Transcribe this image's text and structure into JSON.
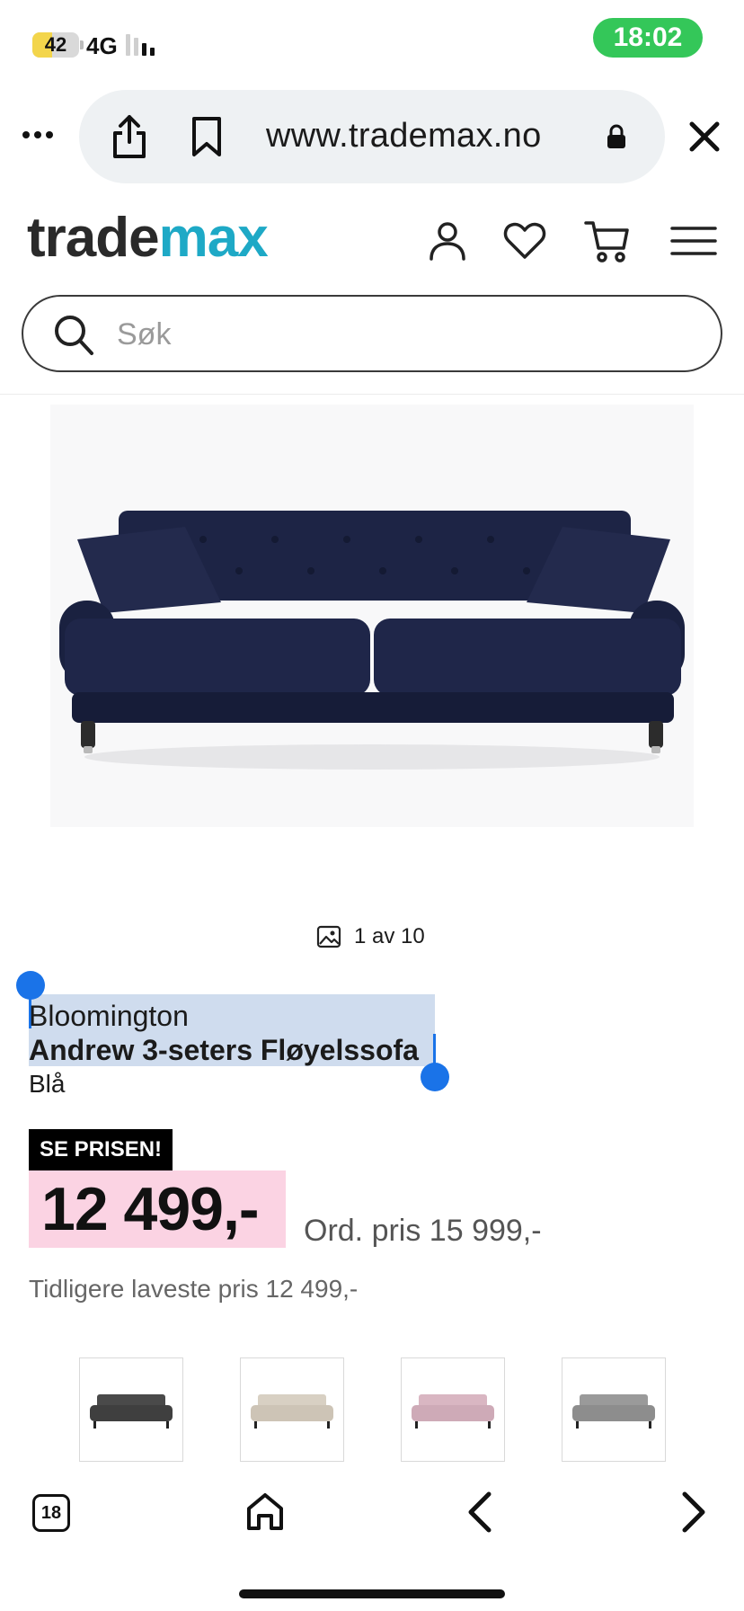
{
  "status_bar": {
    "battery_level": "42",
    "network": "4G",
    "time": "18:02"
  },
  "browser": {
    "url": "www.trademax.no",
    "icons": [
      "more-icon",
      "share-icon",
      "bookmark-icon",
      "lock-icon",
      "close-icon"
    ]
  },
  "header": {
    "logo_part1": "trade",
    "logo_part2": "max",
    "brand_color": "#1ea9c6",
    "icons": [
      "account-icon",
      "heart-icon",
      "cart-icon",
      "hamburger-menu-icon"
    ]
  },
  "search": {
    "placeholder": "Søk",
    "value": ""
  },
  "product": {
    "image_counter": "1 av 10",
    "brand": "Bloomington",
    "title": "Andrew 3-seters Fløyelssofa",
    "color": "Blå",
    "promo_label": "SE PRISEN!",
    "price": "12 499,-",
    "ordinary_price": "Ord. pris 15 999,-",
    "lowest_price": "Tidligere laveste pris 12 499,-",
    "color_variants": [
      {
        "name": "dark-grey",
        "color": "#4a4a4a"
      },
      {
        "name": "beige",
        "color": "#d8d0c3"
      },
      {
        "name": "pink",
        "color": "#d9b6c2"
      },
      {
        "name": "grey",
        "color": "#9a9a9a"
      }
    ],
    "sofa_color": "#1c2340"
  },
  "toolbar": {
    "tab_count": "18",
    "icons": [
      "tabs-icon",
      "home-icon",
      "back-arrow-icon",
      "forward-arrow-icon"
    ]
  },
  "selection_color": "#1a73e8",
  "accent_pink": "#fbd3e3"
}
